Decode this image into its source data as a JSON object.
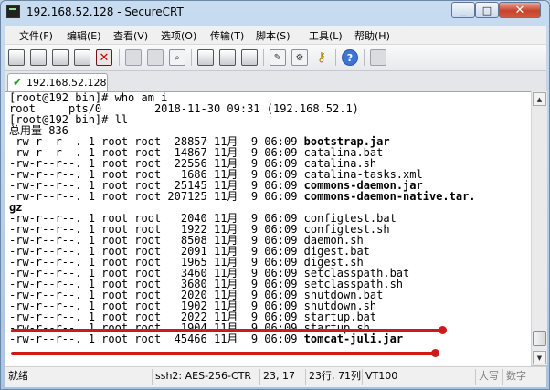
{
  "window": {
    "title": "192.168.52.128 - SecureCRT"
  },
  "titlebar_buttons": {
    "minimize": "_",
    "maximize": "□",
    "close": "✕"
  },
  "menu": [
    "文件(F)",
    "编辑(E)",
    "查看(V)",
    "选项(O)",
    "传输(T)",
    "脚本(S)",
    "工具(L)",
    "帮助(H)"
  ],
  "toolbar_icons": [
    "connect-icon",
    "quick-connect-icon",
    "connect-in-tab-icon",
    "reconnect-icon",
    "disconnect-icon",
    "copy-icon",
    "paste-icon",
    "find-icon",
    "print-icon",
    "print-selection-icon",
    "settings-icon",
    "session-options-icon",
    "keymap-icon",
    "help-icon",
    "minimize-icon"
  ],
  "tab": {
    "label": "192.168.52.128",
    "status_icon": "connected-check-icon"
  },
  "terminal": {
    "lines": [
      "[root@192 bin]# who am i",
      "root     pts/0        2018-11-30 09:31 (192.168.52.1)",
      "[root@192 bin]# ll",
      "总用量 836",
      "-rw-r--r--. 1 root root  28857 11月  9 06:09 ",
      "-rw-r--r--. 1 root root  14867 11月  9 06:09 catalina.bat",
      "-rw-r--r--. 1 root root  22556 11月  9 06:09 catalina.sh",
      "-rw-r--r--. 1 root root   1686 11月  9 06:09 catalina-tasks.xml",
      "-rw-r--r--. 1 root root  25145 11月  9 06:09 ",
      "-rw-r--r--. 1 root root 207125 11月  9 06:09 ",
      "",
      "-rw-r--r--. 1 root root   2040 11月  9 06:09 configtest.bat",
      "-rw-r--r--. 1 root root   1922 11月  9 06:09 configtest.sh",
      "-rw-r--r--. 1 root root   8508 11月  9 06:09 daemon.sh",
      "-rw-r--r--. 1 root root   2091 11月  9 06:09 digest.bat",
      "-rw-r--r--. 1 root root   1965 11月  9 06:09 digest.sh",
      "-rw-r--r--. 1 root root   3460 11月  9 06:09 setclasspath.bat",
      "-rw-r--r--. 1 root root   3680 11月  9 06:09 setclasspath.sh",
      "-rw-r--r--. 1 root root   2020 11月  9 06:09 shutdown.bat",
      "-rw-r--r--. 1 root root   1902 11月  9 06:09 shutdown.sh",
      "-rw-r--r--. 1 root root   2022 11月  9 06:09 startup.bat",
      "-rw-r--r--. 1 root root   1904 11月  9 06:09 startup.sh",
      "-rw-r--r--. 1 root root  45466 11月  9 06:09 "
    ],
    "bold": [
      "bootstrap.jar",
      "",
      "",
      "",
      "commons-daemon.jar",
      "commons-daemon-native.tar.",
      "gz",
      "tomcat-juli.jar"
    ]
  },
  "statusbar": {
    "ready": "就绪",
    "cipher": "ssh2: AES-256-CTR",
    "cursor": "23, 17",
    "size": "23行, 71列",
    "emulation": "VT100",
    "caps": "大写",
    "num": "数字"
  },
  "colors": {
    "annotation": "#d01818",
    "bold_text": "#000000",
    "title_gradient_top": "#c8dcf0"
  }
}
